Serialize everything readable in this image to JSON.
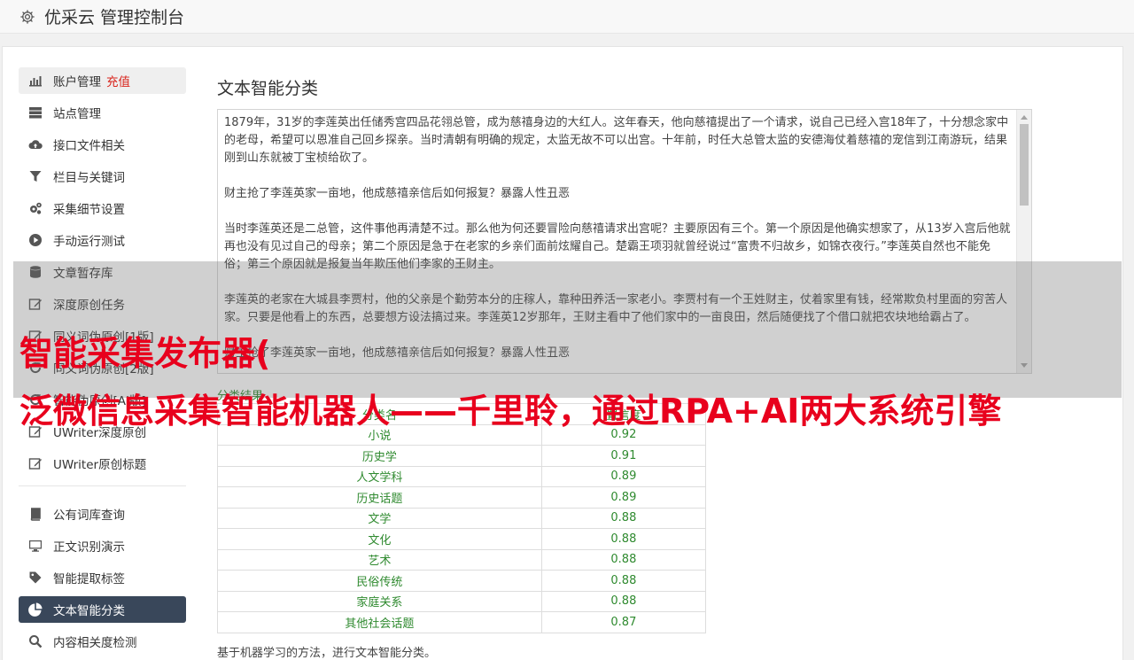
{
  "header": {
    "title": "优采云 管理控制台",
    "icon": "gear-icon"
  },
  "sidebar": {
    "items": [
      {
        "label": "账户管理",
        "extra": "充值",
        "icon": "bar-chart-icon"
      },
      {
        "label": "站点管理",
        "icon": "server-icon"
      },
      {
        "label": "接口文件相关",
        "icon": "cloud-upload-icon"
      },
      {
        "label": "栏目与关键词",
        "icon": "filter-icon"
      },
      {
        "label": "采集细节设置",
        "icon": "gears-icon"
      },
      {
        "label": "手动运行测试",
        "icon": "play-circle-icon"
      },
      {
        "label": "文章暂存库",
        "icon": "database-icon"
      },
      {
        "label": "深度原创任务",
        "icon": "edit-icon"
      },
      {
        "label": "同义词伪原创[1版]",
        "icon": "edit-icon"
      },
      {
        "label": "同义词伪原创[2版]",
        "icon": "refresh-icon"
      },
      {
        "label": "智能伪原创[AI版]",
        "icon": "refresh-icon"
      },
      {
        "label": "UWriter深度原创",
        "icon": "edit-icon"
      },
      {
        "label": "UWriter原创标题",
        "icon": "edit-icon"
      }
    ],
    "items2": [
      {
        "label": "公有词库查询",
        "icon": "book-icon"
      },
      {
        "label": "正文识别演示",
        "icon": "monitor-icon"
      },
      {
        "label": "智能提取标签",
        "icon": "tag-icon"
      },
      {
        "label": "文本智能分类",
        "icon": "pie-chart-icon"
      },
      {
        "label": "内容相关度检测",
        "icon": "search-icon"
      }
    ]
  },
  "main": {
    "title": "文本智能分类",
    "textarea": {
      "paragraphs": [
        "1879年，31岁的李莲英出任储秀宫四品花翎总管，成为慈禧身边的大红人。这年春天，他向慈禧提出了一个请求，说自己已经入宫18年了，十分想念家中的老母，希望可以恩准自己回乡探亲。当时清朝有明确的规定，太监无故不可以出宫。十年前，时任大总管太监的安德海仗着慈禧的宠信到江南游玩，结果刚到山东就被丁宝桢给砍了。",
        "财主抢了李莲英家一亩地，他成慈禧亲信后如何报复？暴露人性丑恶",
        "当时李莲英还是二总管，这件事他再清楚不过。那么他为何还要冒险向慈禧请求出宫呢？主要原因有三个。第一个原因是他确实想家了，从13岁入宫后他就再也没有见过自己的母亲；第二个原因是急于在老家的乡亲们面前炫耀自己。楚霸王项羽就曾经说过“富贵不归故乡，如锦衣夜行。”李莲英自然也不能免俗；第三个原因就是报复当年欺压他们李家的王财主。",
        "李莲英的老家在大城县李贾村，他的父亲是个勤劳本分的庄稼人，靠种田养活一家老小。李贾村有一个王姓财主，仗着家里有钱，经常欺负村里面的穷苦人家。只要是他看上的东西，总要想方设法搞过来。李莲英12岁那年，王财主看中了他们家中的一亩良田，然后随便找了个借口就把农块地给霸占了。",
        "财主抢了李莲英家一亩地，他成慈禧亲信后如何报复？暴露人性丑恶"
      ]
    },
    "result_label": "分类结果",
    "table": {
      "headers": [
        "分类名",
        "置信度"
      ],
      "rows": [
        [
          "小说",
          "0.92"
        ],
        [
          "历史学",
          "0.91"
        ],
        [
          "人文学科",
          "0.89"
        ],
        [
          "历史话题",
          "0.89"
        ],
        [
          "文学",
          "0.88"
        ],
        [
          "文化",
          "0.88"
        ],
        [
          "艺术",
          "0.88"
        ],
        [
          "民俗传统",
          "0.88"
        ],
        [
          "家庭关系",
          "0.88"
        ],
        [
          "其他社会话题",
          "0.87"
        ]
      ]
    },
    "footer_note": "基于机器学习的方法，进行文本智能分类。"
  },
  "overlay": {
    "line1": "智能采集发布器(",
    "line2": "泛微信息采集智能机器人——千里聆，通过RPA+AI两大系统引擎"
  },
  "colors": {
    "accent_active": "#39475a",
    "recharge": "#d9251d",
    "result_green": "#2f8a2f",
    "overlay_text": "#e8001d"
  }
}
